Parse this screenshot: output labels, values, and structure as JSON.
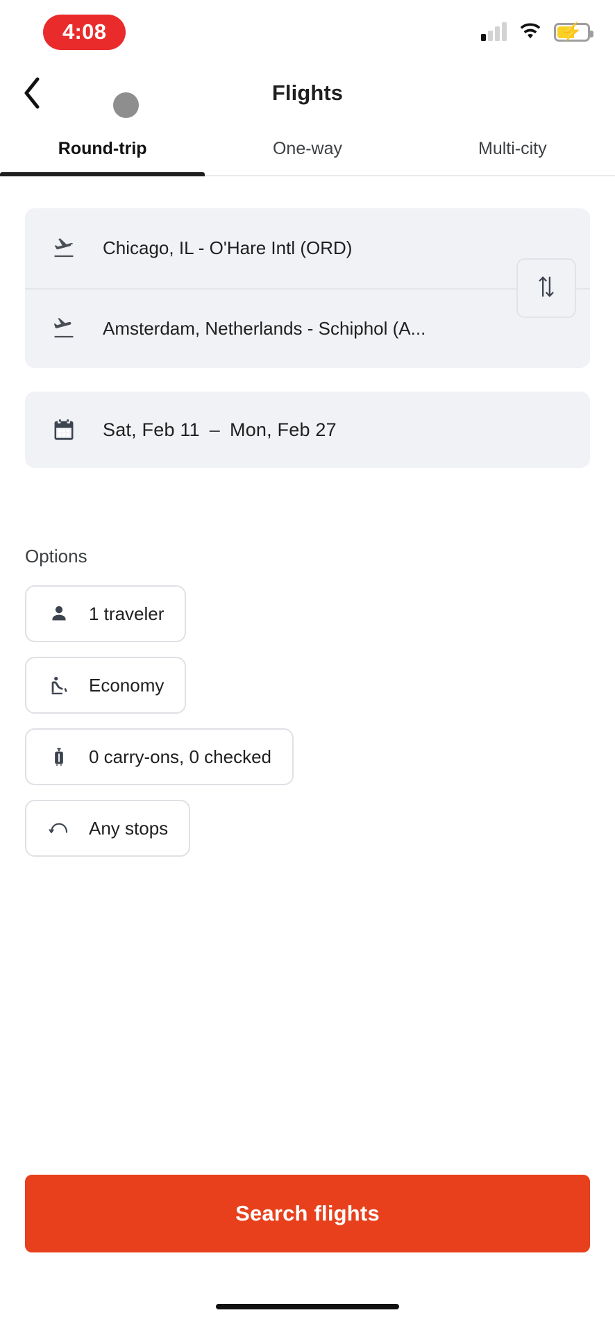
{
  "status_bar": {
    "time": "4:08",
    "time_pill_color": "#ea2b2b",
    "signal_icon": "cellular-signal-icon",
    "wifi_icon": "wifi-icon",
    "battery_icon": "battery-charging-icon",
    "battery_fill_color": "#fbd024"
  },
  "header": {
    "back_icon": "back-chevron-icon",
    "title": "Flights",
    "touch_indicator": "touch-point-indicator"
  },
  "tabs": [
    {
      "label": "Round-trip",
      "active": true
    },
    {
      "label": "One-way",
      "active": false
    },
    {
      "label": "Multi-city",
      "active": false
    }
  ],
  "route": {
    "origin": {
      "icon": "flight-takeoff-icon",
      "value": "Chicago, IL - O'Hare Intl (ORD)"
    },
    "destination": {
      "icon": "flight-land-icon",
      "value": "Amsterdam, Netherlands - Schiphol (A..."
    },
    "swap_icon": "swap-vertical-icon"
  },
  "dates": {
    "icon": "calendar-icon",
    "depart": "Sat, Feb 11",
    "separator": "–",
    "return": "Mon, Feb 27"
  },
  "options": {
    "label": "Options",
    "chips": [
      {
        "icon": "person-icon",
        "label": "1 traveler"
      },
      {
        "icon": "airline-seat-icon",
        "label": "Economy"
      },
      {
        "icon": "luggage-icon",
        "label": "0 carry-ons, 0 checked"
      },
      {
        "icon": "stops-icon",
        "label": "Any stops"
      }
    ]
  },
  "search": {
    "label": "Search flights",
    "color": "#e8401c"
  },
  "system": {
    "home_indicator": "home-indicator-bar"
  }
}
